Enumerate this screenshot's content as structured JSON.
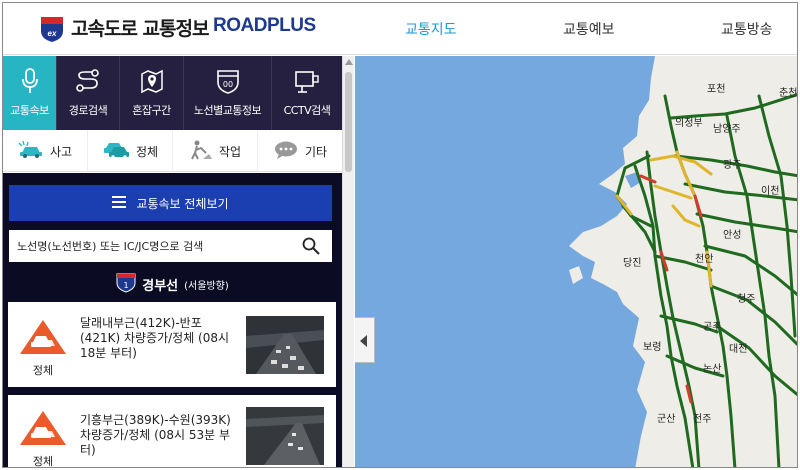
{
  "header": {
    "brand_kr": "고속도로 교통정보",
    "brand_en": "ROADPLUS",
    "logo_text": "ex",
    "nav": [
      "교통지도",
      "교통예보",
      "교통방송"
    ]
  },
  "tabs": [
    {
      "label": "교통속보",
      "icon": "microphone-icon",
      "active": true
    },
    {
      "label": "경로검색",
      "icon": "route-icon"
    },
    {
      "label": "혼잡구간",
      "icon": "map-pin-icon"
    },
    {
      "label": "노선별교통정보",
      "icon": "highway-shield-icon"
    },
    {
      "label": "CCTV검색",
      "icon": "cctv-icon"
    }
  ],
  "filters": [
    {
      "label": "사고",
      "icon": "accident-icon"
    },
    {
      "label": "정체",
      "icon": "congestion-car-icon"
    },
    {
      "label": "작업",
      "icon": "roadwork-icon"
    },
    {
      "label": "기타",
      "icon": "speech-bubble-icon"
    }
  ],
  "full_view_label": "교통속보 전체보기",
  "search_placeholder": "노선명(노선번호) 또는 IC/JC명으로 검색",
  "route": {
    "number": "1",
    "name": "경부선",
    "direction": "(서울방향)"
  },
  "incidents": [
    {
      "badge": "정체",
      "text": "달래내부근(412K)-반포(421K) 차량증가/정체 (08시 18분 부터)"
    },
    {
      "badge": "정체",
      "text": "기흥부근(389K)-수원(393K) 차량증가/정체 (08시 53분 부터)"
    }
  ],
  "map": {
    "cities": [
      "포천",
      "춘천",
      "의정부",
      "남양주",
      "광주",
      "이천",
      "안성",
      "당진",
      "천안",
      "청주",
      "보령",
      "공주",
      "대전",
      "논산",
      "군산",
      "전주"
    ]
  },
  "colors": {
    "accent": "#27b5c4",
    "tab_bg": "#25203f",
    "button_blue": "#1b3fb0",
    "list_bg": "#0b0c23",
    "sea": "#74a8de",
    "land": "#eeede8",
    "road_green": "#1f6a1f",
    "road_yellow": "#e0b52a",
    "road_red": "#d23c2c"
  }
}
